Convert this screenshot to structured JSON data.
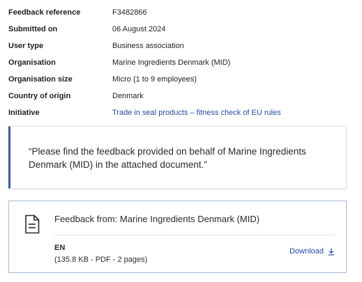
{
  "meta": {
    "rows": [
      {
        "label": "Feedback reference",
        "value": "F3482866"
      },
      {
        "label": "Submitted on",
        "value": "06 August 2024"
      },
      {
        "label": "User type",
        "value": "Business association"
      },
      {
        "label": "Organisation",
        "value": "Marine Ingredients Denmark (MID)"
      },
      {
        "label": "Organisation size",
        "value": "Micro (1 to 9 employees)"
      },
      {
        "label": "Country of origin",
        "value": "Denmark"
      },
      {
        "label": "Initiative",
        "value": "Trade in seal products – fitness check of EU rules"
      }
    ]
  },
  "quote": {
    "text": "“Please find the feedback provided on behalf of Marine Ingredients Denmark (MID) in the attached document.”"
  },
  "attachment": {
    "title": "Feedback from: Marine Ingredients Denmark (MID)",
    "language": "EN",
    "size_info": "(135.8 KB - PDF - 2 pages)",
    "download_label": "Download",
    "icon": "document-icon",
    "download_icon": "download-arrow-icon"
  },
  "colors": {
    "link": "#254aa5",
    "accent_border": "#3b5ea7"
  }
}
